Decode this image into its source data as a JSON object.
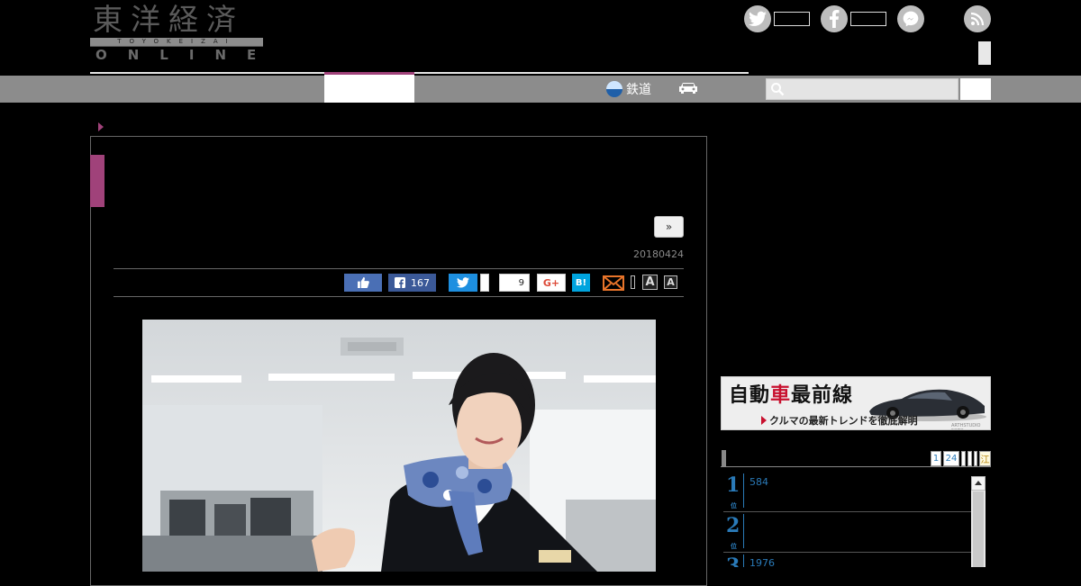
{
  "header": {
    "logo_kanji": "東洋経済",
    "logo_romaji": "TOYOKEIZAI",
    "logo_online": "ONLINE",
    "social": [
      {
        "icon": "twitter-icon",
        "count": ""
      },
      {
        "icon": "facebook-icon",
        "count": ""
      },
      {
        "icon": "messenger-icon"
      },
      {
        "icon": "rss-icon"
      }
    ]
  },
  "nav": {
    "rail_label": "鉄道",
    "rail_icon": "train-icon",
    "car_icon": "car-icon",
    "search": {
      "placeholder": "",
      "value": ""
    },
    "accent_color": "#a0427a"
  },
  "article": {
    "next_label": "»",
    "date": "20180424",
    "share": {
      "facebook_count": "167",
      "twitter_count": "",
      "pocket_count": "9",
      "google_label": "G+",
      "hatena_label": "B!",
      "font_large": "A",
      "font_small": "A"
    }
  },
  "sidebar": {
    "banner": {
      "title_a": "自動",
      "title_red": "車",
      "title_b": "最前線",
      "subtitle": "クルマの最新トレンドを徹底解明",
      "credit": "ARTHSTUDIO FOTO"
    },
    "ranking": {
      "tabs": [
        "1",
        "24",
        "",
        "",
        "",
        "江"
      ],
      "items": [
        {
          "rank": "1",
          "suffix": "位",
          "count": "584"
        },
        {
          "rank": "2",
          "suffix": "位",
          "count": ""
        },
        {
          "rank": "3",
          "suffix": "位",
          "count": "1976"
        }
      ]
    }
  }
}
